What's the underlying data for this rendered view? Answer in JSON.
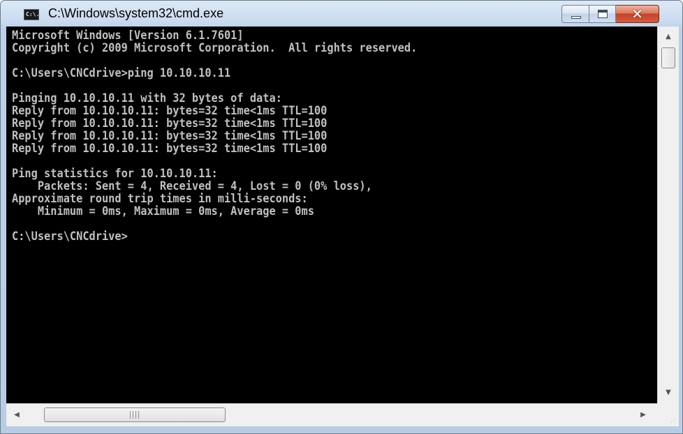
{
  "window": {
    "title": "C:\\Windows\\system32\\cmd.exe",
    "icon_label": "C:\\."
  },
  "titlebar": {
    "minimize_icon": "minimize-icon",
    "maximize_icon": "maximize-icon",
    "close_icon": "close-icon",
    "close_glyph": "✕"
  },
  "console": {
    "background_color": "#000000",
    "text_color": "#c0c0c0",
    "text": "Microsoft Windows [Version 6.1.7601]\nCopyright (c) 2009 Microsoft Corporation.  All rights reserved.\n\nC:\\Users\\CNCdrive>ping 10.10.10.11\n\nPinging 10.10.10.11 with 32 bytes of data:\nReply from 10.10.10.11: bytes=32 time<1ms TTL=100\nReply from 10.10.10.11: bytes=32 time<1ms TTL=100\nReply from 10.10.10.11: bytes=32 time<1ms TTL=100\nReply from 10.10.10.11: bytes=32 time<1ms TTL=100\n\nPing statistics for 10.10.10.11:\n    Packets: Sent = 4, Received = 4, Lost = 0 (0% loss),\nApproximate round trip times in milli-seconds:\n    Minimum = 0ms, Maximum = 0ms, Average = 0ms\n\nC:\\Users\\CNCdrive>"
  },
  "scrollbars": {
    "up_arrow": "▲",
    "down_arrow": "▼",
    "left_arrow": "◀",
    "right_arrow": "▶",
    "size_grip": "⋰"
  }
}
